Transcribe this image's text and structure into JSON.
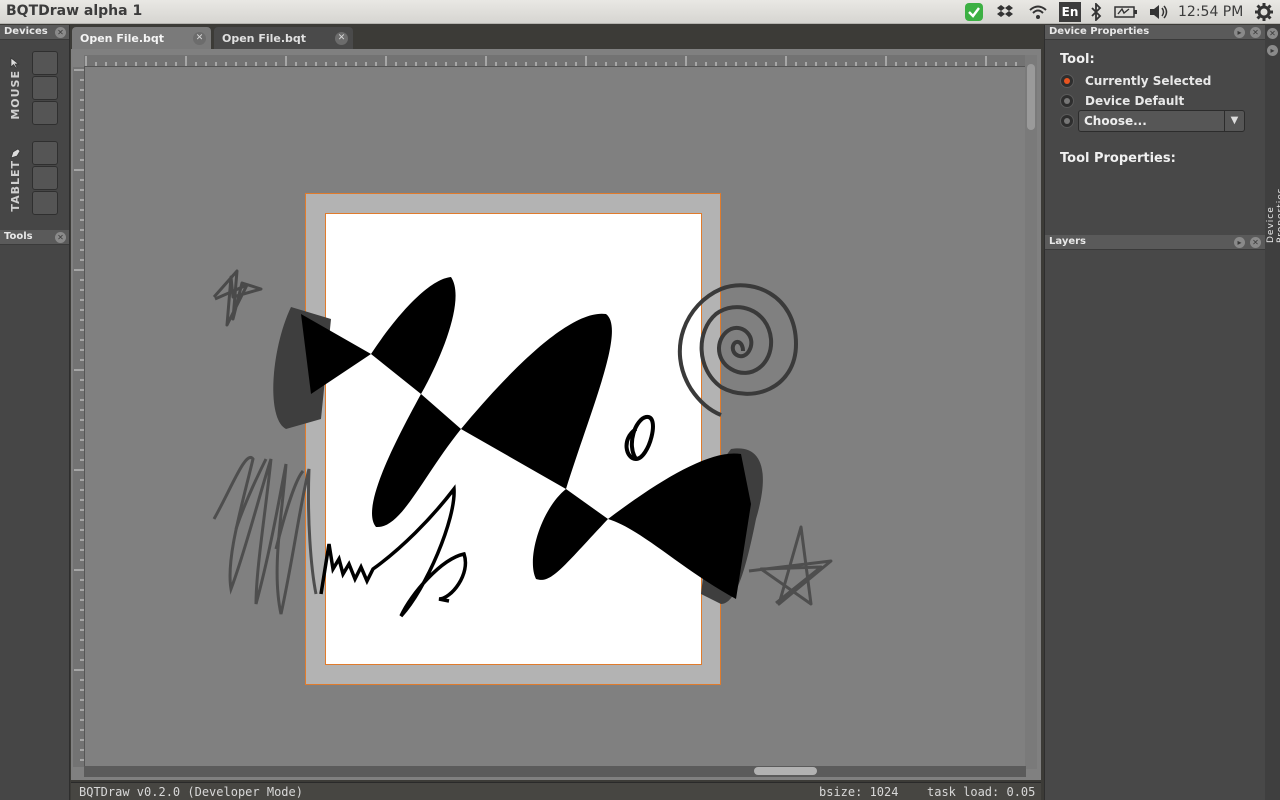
{
  "app": {
    "title": "BQTDraw alpha 1"
  },
  "system_tray": {
    "language": "En",
    "clock": "12:54 PM",
    "icons": [
      "check-shield-icon",
      "dropbox-icon",
      "wifi-icon",
      "bluetooth-icon",
      "battery-icon",
      "volume-icon",
      "gear-icon"
    ]
  },
  "left_dock": {
    "devices_title": "Devices",
    "mouse_label": "MOUSE",
    "tablet_label": "TABLET",
    "tools_title": "Tools"
  },
  "tabs": [
    {
      "label": "Open File.bqt",
      "active": true
    },
    {
      "label": "Open File.bqt",
      "active": false
    }
  ],
  "right_dock": {
    "device_properties_title": "Device Properties",
    "tool_heading": "Tool:",
    "options": [
      "Currently Selected",
      "Device Default"
    ],
    "selected_option": "Currently Selected",
    "choose_value": "Choose...",
    "tool_properties_heading": "Tool Properties:",
    "layers_title": "Layers",
    "side_tab_label": "Device Properties"
  },
  "status_bar": {
    "version": "BQTDraw v0.2.0 (Developer Mode)",
    "bsize": "bsize: 1024",
    "task_load": "task load: 0.05"
  },
  "colors": {
    "accent": "#e95420",
    "page_border": "#e07b2c",
    "canvas_bg": "#808080"
  }
}
